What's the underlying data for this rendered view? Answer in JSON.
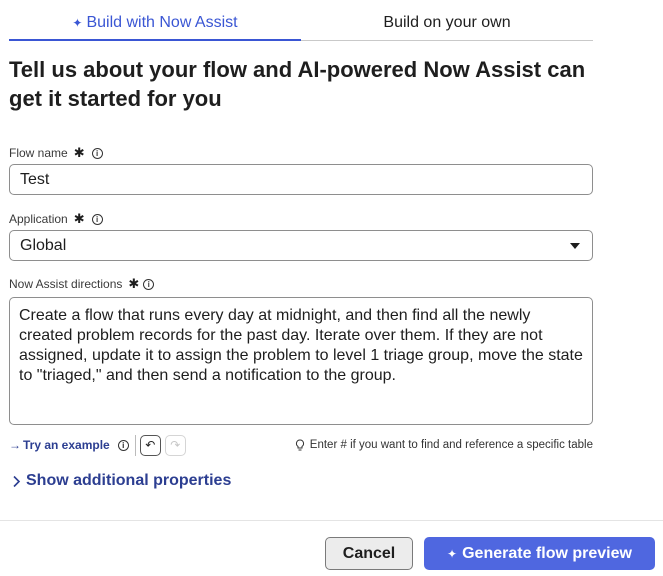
{
  "tabs": {
    "assist_label": "Build with Now Assist",
    "own_label": "Build on your own"
  },
  "heading": "Tell us about your flow and AI-powered Now Assist can get it started for you",
  "fields": {
    "flow_name": {
      "label": "Flow name",
      "value": "Test"
    },
    "application": {
      "label": "Application",
      "value": "Global"
    },
    "directions": {
      "label": "Now Assist directions",
      "value": "Create a flow that runs every day at midnight, and then find all the newly created problem records for the past day. Iterate over them. If they are not assigned, update it to assign the problem to level 1 triage group, move the state to \"triaged,\" and then send a notification to the group."
    }
  },
  "helper": {
    "try_example": "Try an example",
    "hint": "Enter # if you want to find and reference a specific table"
  },
  "show_more": "Show additional properties",
  "buttons": {
    "cancel": "Cancel",
    "generate": "Generate flow preview"
  },
  "colors": {
    "accent": "#3a56d4",
    "primary_button": "#4f67e0",
    "link": "#2c3e91"
  }
}
